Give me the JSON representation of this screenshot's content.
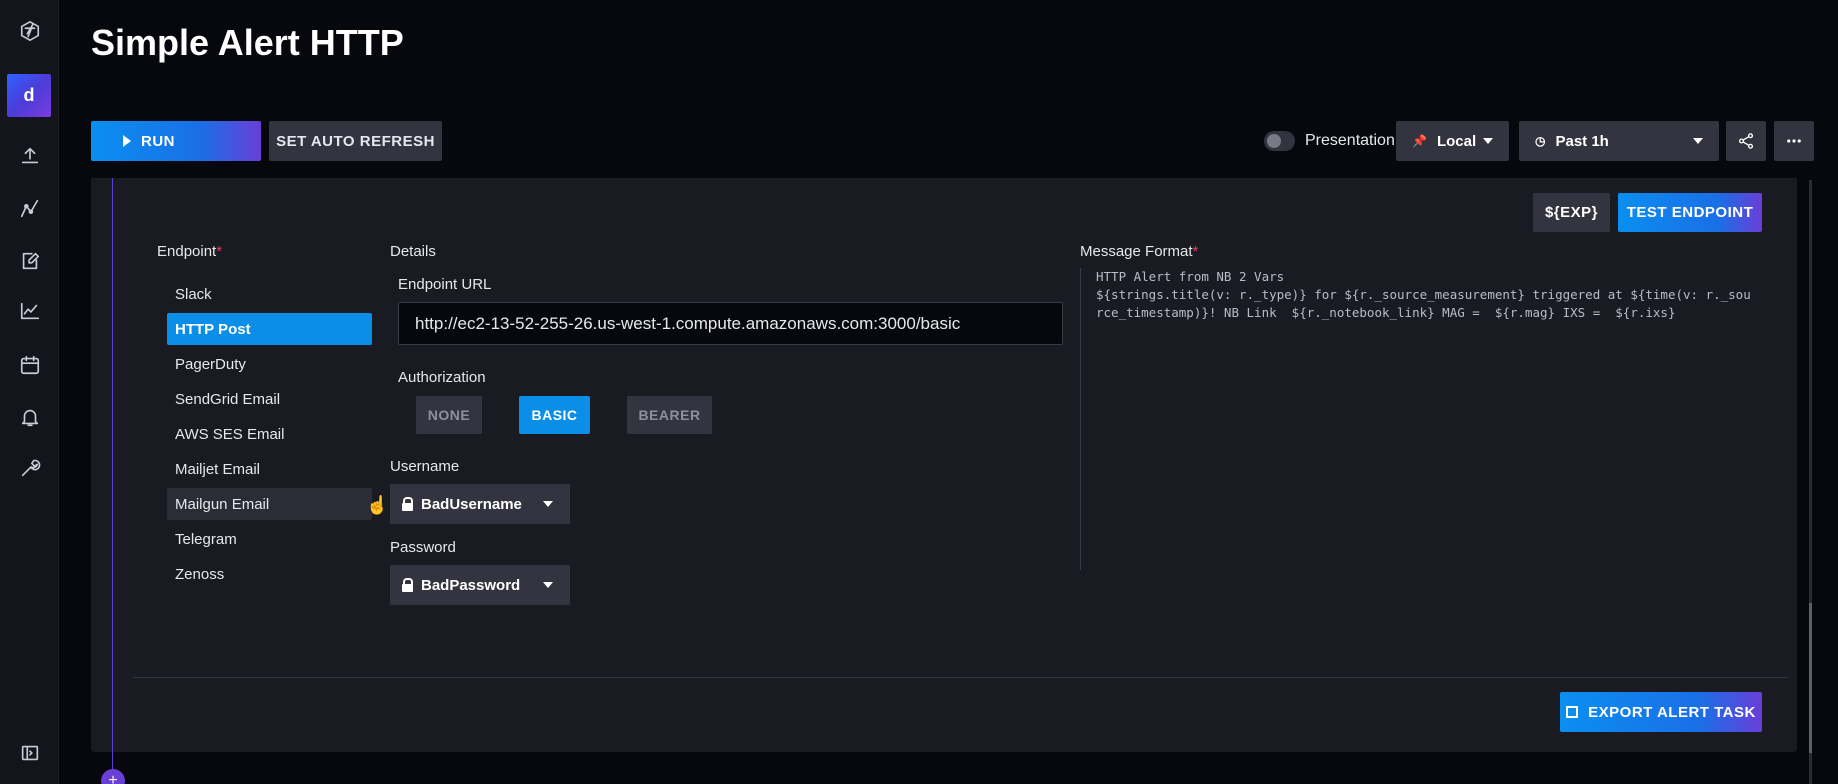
{
  "page": {
    "title": "Simple Alert HTTP"
  },
  "nav": {
    "avatar_letter": "d",
    "icons": [
      "logo-icon",
      "avatar",
      "upload-icon",
      "data-explorer-icon",
      "notebook-icon",
      "dashboard-icon",
      "tasks-icon",
      "alerts-icon",
      "settings-icon",
      "collapse-icon"
    ]
  },
  "toolbar": {
    "run_label": "RUN",
    "autorefresh_label": "SET AUTO REFRESH",
    "presentation_label": "Presentation",
    "presentation_enabled": false,
    "local_label": "Local",
    "time_range_label": "Past 1h"
  },
  "panel": {
    "exp_label": "${EXP}",
    "test_endpoint_label": "TEST ENDPOINT",
    "endpoint_heading": "Endpoint",
    "endpoints": [
      {
        "label": "Slack",
        "state": ""
      },
      {
        "label": "HTTP Post",
        "state": "active"
      },
      {
        "label": "PagerDuty",
        "state": ""
      },
      {
        "label": "SendGrid Email",
        "state": ""
      },
      {
        "label": "AWS SES Email",
        "state": ""
      },
      {
        "label": "Mailjet Email",
        "state": ""
      },
      {
        "label": "Mailgun Email",
        "state": "hover"
      },
      {
        "label": "Telegram",
        "state": ""
      },
      {
        "label": "Zenoss",
        "state": ""
      }
    ],
    "details_heading": "Details",
    "endpoint_url_label": "Endpoint URL",
    "endpoint_url_value": "http://ec2-13-52-255-26.us-west-1.compute.amazonaws.com:3000/basic",
    "authorization_label": "Authorization",
    "auth_none": "NONE",
    "auth_basic": "BASIC",
    "auth_bearer": "BEARER",
    "auth_selected": "BASIC",
    "username_label": "Username",
    "username_value": "BadUsername",
    "password_label": "Password",
    "password_value": "BadPassword",
    "message_format_heading": "Message Format",
    "message_format_value": "HTTP Alert from NB 2 Vars\n${strings.title(v: r._type)} for ${r._source_measurement} triggered at ${time(v: r._source_timestamp)}! NB Link  ${r._notebook_link} MAG =  ${r.mag} IXS =  ${r.ixs}",
    "export_label": "EXPORT ALERT TASK"
  },
  "colors": {
    "accent_blue": "#0b8ee8",
    "gradient_purple": "#6a3ed8",
    "required_red": "#e53c5a",
    "panel_bg": "#1a1b22",
    "button_gray": "#33343f"
  }
}
